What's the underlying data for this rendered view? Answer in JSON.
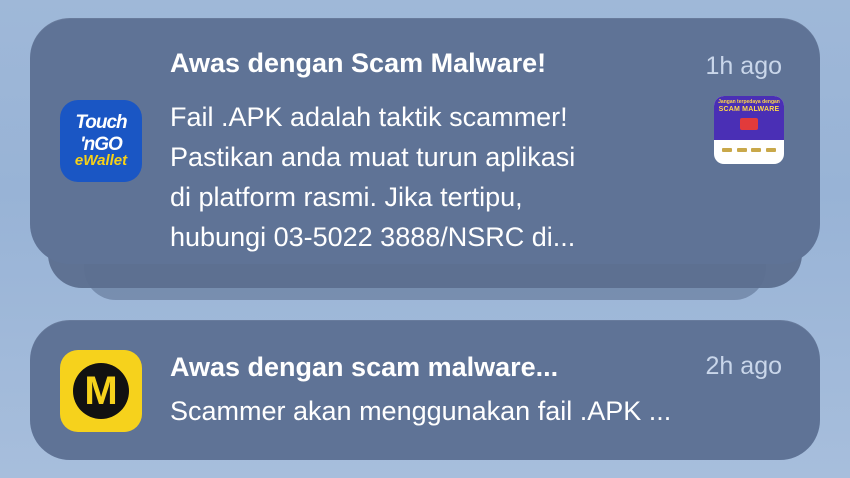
{
  "notifications": [
    {
      "app": "Touch 'n Go eWallet",
      "icon_text_top": "Touch 'nGO",
      "icon_text_bottom": "eWallet",
      "title": "Awas dengan Scam Malware!",
      "time": "1h ago",
      "body_lines": [
        "Fail .APK adalah taktik scammer!",
        "Pastikan anda muat turun aplikasi",
        "di platform rasmi. Jika tertipu,",
        "hubungi 03-5022 3888/NSRC di..."
      ],
      "thumbnail": {
        "small_text": "Jangan terpedaya dengan",
        "label": "SCAM MALWARE",
        "badge": "APK"
      }
    },
    {
      "app": "M",
      "icon_letter": "M",
      "title": "Awas dengan scam malware...",
      "time": "2h ago",
      "body_lines": [
        "Scammer akan menggunakan fail .APK ..."
      ]
    }
  ],
  "colors": {
    "card": "#5f7396",
    "tng_blue": "#1a56c4",
    "tng_yellow": "#f7d117",
    "m_yellow": "#f6d21c",
    "time_text": "#c9d6ea"
  }
}
